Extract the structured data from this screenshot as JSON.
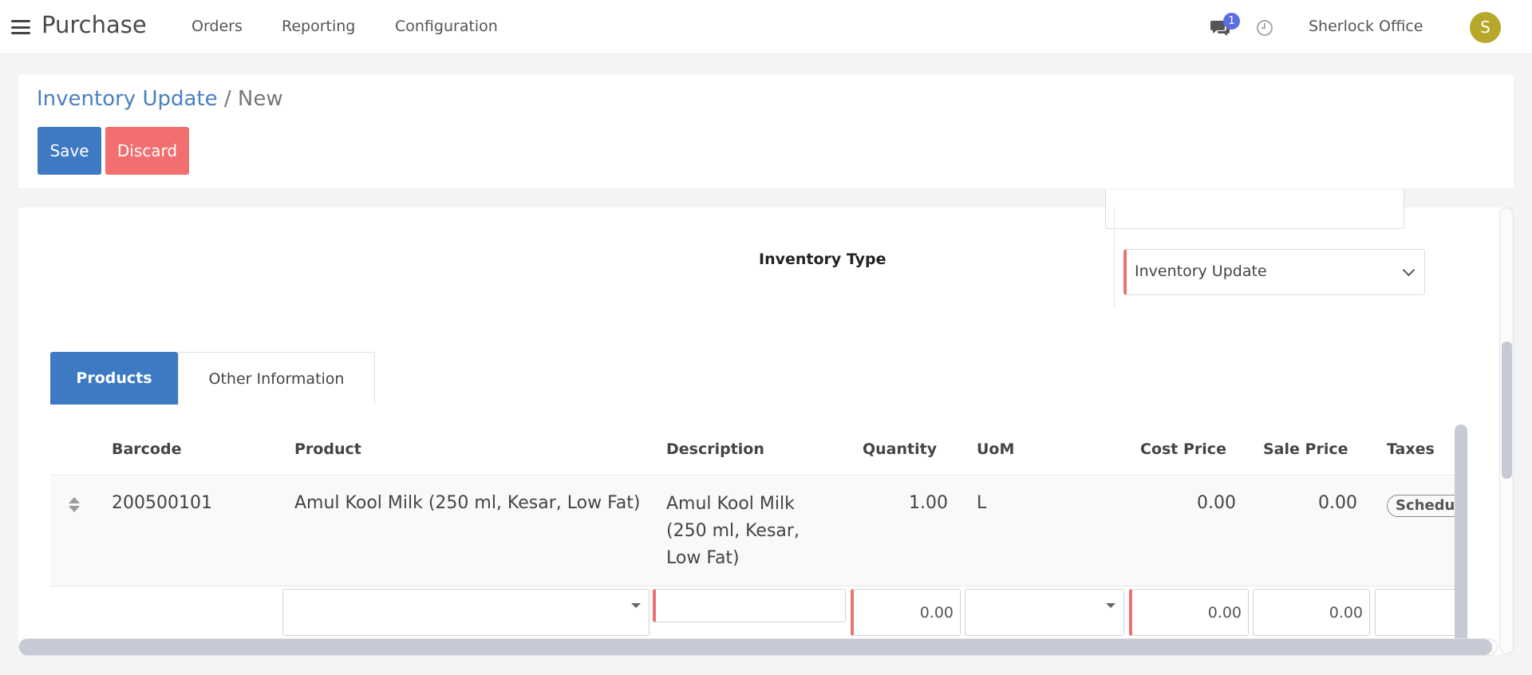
{
  "nav": {
    "app_title": "Purchase",
    "menu": [
      "Orders",
      "Reporting",
      "Configuration"
    ],
    "notification_count": "1",
    "user_name": "Sherlock Office",
    "avatar_initial": "S"
  },
  "control": {
    "breadcrumb_root": "Inventory Update",
    "breadcrumb_sep": "/",
    "breadcrumb_current": "New",
    "save_label": "Save",
    "discard_label": "Discard"
  },
  "form": {
    "inventory_type_label": "Inventory Type",
    "inventory_type_value": "Inventory Update"
  },
  "tabs": [
    "Products",
    "Other Information"
  ],
  "table": {
    "headers": [
      "Barcode",
      "Product",
      "Description",
      "Quantity",
      "UoM",
      "Cost Price",
      "Sale Price",
      "Taxes"
    ],
    "rows": [
      {
        "barcode": "200500101",
        "product": "Amul Kool Milk (250 ml, Kesar, Low Fat)",
        "description_lines": [
          "Amul Kool Milk",
          "(250 ml, Kesar,",
          "Low Fat)"
        ],
        "quantity": "1.00",
        "uom": "L",
        "cost_price": "0.00",
        "sale_price": "0.00",
        "taxes": "Schedul"
      }
    ],
    "new_row": {
      "quantity": "0.00",
      "cost_price": "0.00",
      "sale_price": "0.00"
    }
  },
  "colors": {
    "primary": "#3e79c3",
    "danger": "#f26f6f",
    "avatar": "#b8a82a",
    "badge": "#5a6fe0",
    "required_border": "#e97272"
  }
}
